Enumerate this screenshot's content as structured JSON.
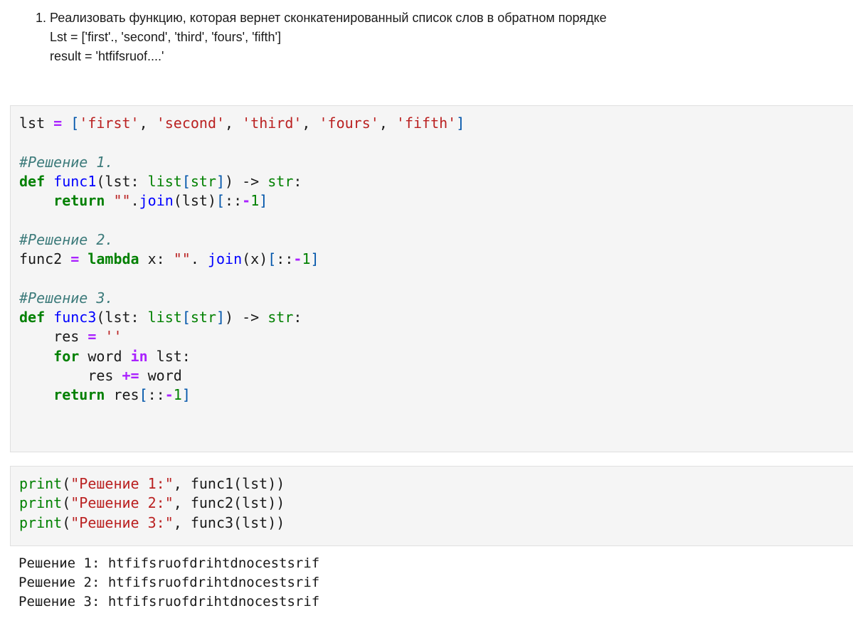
{
  "markdown": {
    "item_number": "1.",
    "task_text": "Реализовать функцию, которая вернет сконкатенированный список слов в обратном порядке",
    "example_list": "Lst = ['first'., 'second', 'third', 'fours', 'fifth']",
    "example_result": "result = 'htfifsruof....'"
  },
  "code_cell_1": {
    "lines": [
      [
        {
          "t": "lst ",
          "c": "p"
        },
        {
          "t": "=",
          "c": "op"
        },
        {
          "t": " ",
          "c": "p"
        },
        {
          "t": "[",
          "c": "br"
        },
        {
          "t": "'first'",
          "c": "str"
        },
        {
          "t": ", ",
          "c": "p"
        },
        {
          "t": "'second'",
          "c": "str"
        },
        {
          "t": ", ",
          "c": "p"
        },
        {
          "t": "'third'",
          "c": "str"
        },
        {
          "t": ", ",
          "c": "p"
        },
        {
          "t": "'fours'",
          "c": "str"
        },
        {
          "t": ", ",
          "c": "p"
        },
        {
          "t": "'fifth'",
          "c": "str"
        },
        {
          "t": "]",
          "c": "br"
        }
      ],
      [],
      [
        {
          "t": "#Решение 1.",
          "c": "com"
        }
      ],
      [
        {
          "t": "def",
          "c": "kw"
        },
        {
          "t": " ",
          "c": "p"
        },
        {
          "t": "func1",
          "c": "fn"
        },
        {
          "t": "(lst: ",
          "c": "p"
        },
        {
          "t": "list",
          "c": "bi"
        },
        {
          "t": "[",
          "c": "br"
        },
        {
          "t": "str",
          "c": "bi"
        },
        {
          "t": "]",
          "c": "br"
        },
        {
          "t": ") -> ",
          "c": "p"
        },
        {
          "t": "str",
          "c": "bi"
        },
        {
          "t": ":",
          "c": "p"
        }
      ],
      [
        {
          "t": "    ",
          "c": "p"
        },
        {
          "t": "return",
          "c": "kw"
        },
        {
          "t": " ",
          "c": "p"
        },
        {
          "t": "\"\"",
          "c": "str"
        },
        {
          "t": ".",
          "c": "p"
        },
        {
          "t": "join",
          "c": "fn"
        },
        {
          "t": "(lst)",
          "c": "p"
        },
        {
          "t": "[",
          "c": "br"
        },
        {
          "t": "::",
          "c": "p"
        },
        {
          "t": "-",
          "c": "op"
        },
        {
          "t": "1",
          "c": "num"
        },
        {
          "t": "]",
          "c": "br"
        }
      ],
      [],
      [
        {
          "t": "#Решение 2.",
          "c": "com"
        }
      ],
      [
        {
          "t": "func2 ",
          "c": "p"
        },
        {
          "t": "=",
          "c": "op"
        },
        {
          "t": " ",
          "c": "p"
        },
        {
          "t": "lambda",
          "c": "kw"
        },
        {
          "t": " x: ",
          "c": "p"
        },
        {
          "t": "\"\"",
          "c": "str"
        },
        {
          "t": ". ",
          "c": "p"
        },
        {
          "t": "join",
          "c": "fn"
        },
        {
          "t": "(x)",
          "c": "p"
        },
        {
          "t": "[",
          "c": "br"
        },
        {
          "t": "::",
          "c": "p"
        },
        {
          "t": "-",
          "c": "op"
        },
        {
          "t": "1",
          "c": "num"
        },
        {
          "t": "]",
          "c": "br"
        }
      ],
      [],
      [
        {
          "t": "#Решение 3.",
          "c": "com"
        }
      ],
      [
        {
          "t": "def",
          "c": "kw"
        },
        {
          "t": " ",
          "c": "p"
        },
        {
          "t": "func3",
          "c": "fn"
        },
        {
          "t": "(lst: ",
          "c": "p"
        },
        {
          "t": "list",
          "c": "bi"
        },
        {
          "t": "[",
          "c": "br"
        },
        {
          "t": "str",
          "c": "bi"
        },
        {
          "t": "]",
          "c": "br"
        },
        {
          "t": ") -> ",
          "c": "p"
        },
        {
          "t": "str",
          "c": "bi"
        },
        {
          "t": ":",
          "c": "p"
        }
      ],
      [
        {
          "t": "    res ",
          "c": "p"
        },
        {
          "t": "=",
          "c": "op"
        },
        {
          "t": " ",
          "c": "p"
        },
        {
          "t": "''",
          "c": "str"
        }
      ],
      [
        {
          "t": "    ",
          "c": "p"
        },
        {
          "t": "for",
          "c": "kw"
        },
        {
          "t": " word ",
          "c": "p"
        },
        {
          "t": "in",
          "c": "op"
        },
        {
          "t": " lst:",
          "c": "p"
        }
      ],
      [
        {
          "t": "        res ",
          "c": "p"
        },
        {
          "t": "+=",
          "c": "op"
        },
        {
          "t": " word",
          "c": "p"
        }
      ],
      [
        {
          "t": "    ",
          "c": "p"
        },
        {
          "t": "return",
          "c": "kw"
        },
        {
          "t": " res",
          "c": "p"
        },
        {
          "t": "[",
          "c": "br"
        },
        {
          "t": "::",
          "c": "p"
        },
        {
          "t": "-",
          "c": "op"
        },
        {
          "t": "1",
          "c": "num"
        },
        {
          "t": "]",
          "c": "br"
        }
      ]
    ]
  },
  "code_cell_2": {
    "lines": [
      [
        {
          "t": "print",
          "c": "bi"
        },
        {
          "t": "(",
          "c": "p"
        },
        {
          "t": "\"Решение 1:\"",
          "c": "str"
        },
        {
          "t": ", func1(lst))",
          "c": "p"
        }
      ],
      [
        {
          "t": "print",
          "c": "bi"
        },
        {
          "t": "(",
          "c": "p"
        },
        {
          "t": "\"Решение 2:\"",
          "c": "str"
        },
        {
          "t": ", func2(lst))",
          "c": "p"
        }
      ],
      [
        {
          "t": "print",
          "c": "bi"
        },
        {
          "t": "(",
          "c": "p"
        },
        {
          "t": "\"Решение 3:\"",
          "c": "str"
        },
        {
          "t": ", func3(lst))",
          "c": "p"
        }
      ]
    ]
  },
  "output": {
    "lines": [
      "Решение 1: htfifsruofdrihtdnocestsrif",
      "Решение 2: htfifsruofdrihtdnocestsrif",
      "Решение 3: htfifsruofdrihtdnocestsrif"
    ]
  }
}
